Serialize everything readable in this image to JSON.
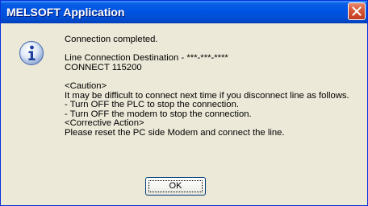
{
  "window": {
    "title": "MELSOFT Application"
  },
  "dialog": {
    "icon": "info-icon",
    "lines": [
      "Connection completed.",
      "",
      "Line Connection Destination - ***-***-****",
      "CONNECT 115200",
      "",
      "<Caution>",
      "It may be difficult to connect next time if you disconnect line as follows.",
      "- Turn OFF the PLC to stop the connection.",
      "- Turn OFF the modem to stop the connection.",
      "<Corrective Action>",
      "Please reset the PC side Modem and connect the line."
    ],
    "ok_label": "OK"
  },
  "colors": {
    "titlebar": "#0054e3",
    "close_button": "#d85a3a",
    "dialog_background": "#ece9d8"
  }
}
